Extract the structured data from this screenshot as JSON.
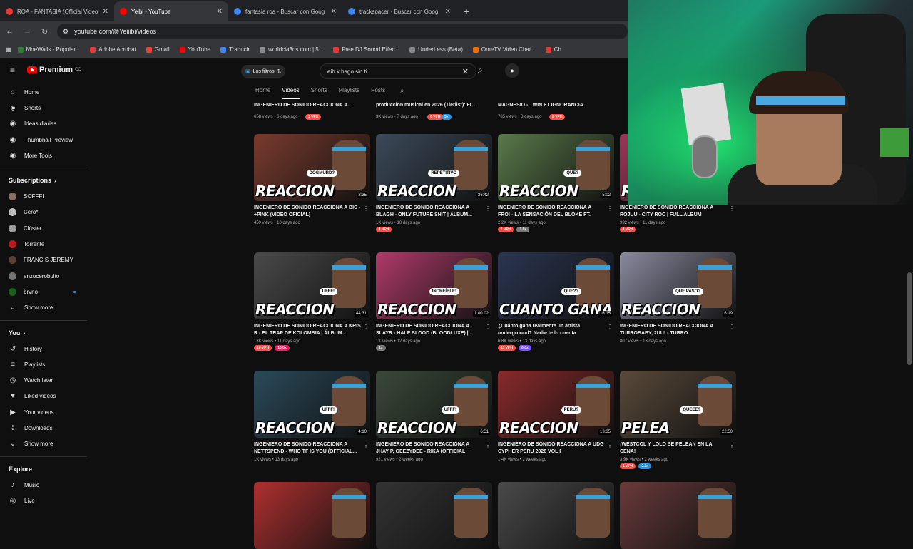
{
  "browser": {
    "tabs": [
      {
        "title": "ROA - FANTASÍA (Official Video",
        "color": "#e53935",
        "active": false
      },
      {
        "title": "Yeibi - YouTube",
        "color": "#ff0000",
        "active": true
      },
      {
        "title": "fantasía roa - Buscar con Goog",
        "color": "#4285f4",
        "active": false
      },
      {
        "title": "trackspacer - Buscar con Goog",
        "color": "#4285f4",
        "active": false
      }
    ],
    "new_tab": "+",
    "url": "youtube.com/@Yeiiibi/videos",
    "bookmarks": [
      {
        "label": "MoeWalls - Popular...",
        "color": "#2e7d32"
      },
      {
        "label": "Adobe Acrobat",
        "color": "#e53935"
      },
      {
        "label": "Gmail",
        "color": "#ea4335"
      },
      {
        "label": "YouTube",
        "color": "#ff0000"
      },
      {
        "label": "Traducir",
        "color": "#4285f4"
      },
      {
        "label": "worldcia3ds.com | 5...",
        "color": "#888888"
      },
      {
        "label": "Free DJ Sound Effec...",
        "color": "#e53935"
      },
      {
        "label": "UnderLess (Beta)",
        "color": "#888888"
      },
      {
        "label": "OmeTV Video Chat...",
        "color": "#ef6c00"
      },
      {
        "label": "Ch",
        "color": "#e53935"
      }
    ]
  },
  "yt": {
    "logo": "Premium",
    "logo_sup": "CO",
    "filters_label": "Los filtros",
    "search_value": "eib k hago sin ti",
    "sidebar": {
      "main": [
        {
          "label": "Home",
          "icon": "⌂"
        },
        {
          "label": "Shorts",
          "icon": "◈"
        },
        {
          "label": "Ideas diarias",
          "icon": "◉"
        },
        {
          "label": "Thumbnail Preview",
          "icon": "◉"
        },
        {
          "label": "More Tools",
          "icon": "◉"
        }
      ],
      "subs_title": "Subscriptions",
      "subs": [
        {
          "label": "SOFFFI",
          "color": "#8d6e63"
        },
        {
          "label": "Cero*",
          "color": "#bdbdbd"
        },
        {
          "label": "Clúster",
          "color": "#9e9e9e"
        },
        {
          "label": "Torrente",
          "color": "#b71c1c"
        },
        {
          "label": "FRANCIS JEREMY",
          "color": "#5d4037"
        },
        {
          "label": "enzocerobulto",
          "color": "#757575"
        },
        {
          "label": "brvno",
          "color": "#1b5e20"
        }
      ],
      "show_more": "Show more",
      "you_title": "You",
      "you": [
        {
          "label": "History",
          "icon": "↺"
        },
        {
          "label": "Playlists",
          "icon": "≡"
        },
        {
          "label": "Watch later",
          "icon": "◷"
        },
        {
          "label": "Liked videos",
          "icon": "♥"
        },
        {
          "label": "Your videos",
          "icon": "▶"
        },
        {
          "label": "Downloads",
          "icon": "⇣"
        }
      ],
      "show_more_2": "Show more",
      "explore_title": "Explore",
      "explore": [
        {
          "label": "Music",
          "icon": "♪"
        },
        {
          "label": "Live",
          "icon": "◎"
        }
      ]
    },
    "channel_tabs": [
      "Home",
      "Videos",
      "Shorts",
      "Playlists",
      "Posts"
    ],
    "top_row": [
      {
        "title": "INGENIERO DE SONIDO REACCIONA A...",
        "meta": "658 views • 6 days ago",
        "badge": "1 VPH"
      },
      {
        "title": "producción musical en 2026 (Tierlist): FL...",
        "meta": "3K views • 7 days ago",
        "badge": "6 VPH",
        "badge2": "3x"
      },
      {
        "title": "MAGNESIO - TWIN FT IGNORANCIA",
        "meta": "735 views • 8 days ago",
        "badge": "2 VPH"
      }
    ],
    "videos": [
      {
        "big": "REACCION",
        "bubble": "DOGMURD?",
        "dur": "3:35",
        "bg": "#7a3b2e",
        "title": "INGENIERO DE SONIDO REACCIONA A BIC - +PINK (VIDEO OFICIAL)",
        "meta": "459 views • 10 days ago",
        "badges": []
      },
      {
        "big": "REACCION",
        "bubble": "REPETITIVO",
        "dur": "36:42",
        "bg": "#3b4a5a",
        "title": "INGENIERO DE SONIDO REACCIONA A BLAGH - ONLY FUTURE SHIT | ÁLBUM...",
        "meta": "1K views • 10 days ago",
        "badges": [
          {
            "t": "1 VPH",
            "c": "#ff4e45"
          }
        ]
      },
      {
        "big": "REACCION",
        "bubble": "QUE?",
        "dur": "5:02",
        "bg": "#5a7a4a",
        "title": "INGENIERO DE SONIDO REACCIONA A FRO! - LA SENSACIÓN DEL BLOKE FT. PABLOXO",
        "meta": "2.2K views • 11 days ago",
        "badges": [
          {
            "t": "1 VPH",
            "c": "#ff4e45"
          },
          {
            "t": "1.8x",
            "c": "#777777"
          }
        ]
      },
      {
        "big": "REACCION",
        "bubble": "",
        "dur": "",
        "bg": "#a0365a",
        "title": "INGENIERO DE SONIDO REACCIONA A ROJUU - CITY ROC | FULL ALBUM",
        "meta": "932 views • 11 days ago",
        "badges": [
          {
            "t": "1 VPH",
            "c": "#ff4e45"
          }
        ]
      },
      {
        "big": "REACCION",
        "bubble": "UFFF!",
        "dur": "44:31",
        "bg": "#4a4a4a",
        "title": "INGENIERO DE SONIDO REACCIONA A KRIS R - EL TRAP DE KOLOMBIA | ÁLBUM...",
        "meta": "13K views • 11 days ago",
        "badges": [
          {
            "t": "18 VPH",
            "c": "#ff4e45"
          },
          {
            "t": "13.8x",
            "c": "#e91e63"
          }
        ]
      },
      {
        "big": "REACCION",
        "bubble": "INCREÍBLE!",
        "dur": "1:00:02",
        "bg": "#b03a6a",
        "title": "INGENIERO DE SONIDO REACCIONA A SLAYR - HALF BLOOD (BLOODLUXE) |...",
        "meta": "1K views • 12 days ago",
        "badges": [
          {
            "t": "1x",
            "c": "#777777"
          }
        ]
      },
      {
        "big": "CUANTO GANA",
        "bubble": "QUE??",
        "dur": "16:15",
        "bg": "#2a3550",
        "title": "¿Cuánto gana realmente un artista underground? Nadie te lo cuenta",
        "meta": "6.8K views • 13 days ago",
        "badges": [
          {
            "t": "11 VPH",
            "c": "#ff4e45"
          },
          {
            "t": "6.0x",
            "c": "#7c4dff"
          }
        ]
      },
      {
        "big": "REACCION",
        "bubble": "QUE PASO?",
        "dur": "6:19",
        "bg": "#8a8aa0",
        "title": "INGENIERO DE SONIDO REACCIONA A TURROBABY, 2UU! - TURRO",
        "meta": "807 views • 13 days ago",
        "badges": []
      },
      {
        "big": "REACCION",
        "bubble": "UFFF!",
        "dur": "4:10",
        "bg": "#2a4a5a",
        "title": "INGENIERO DE SONIDO REACCIONA A NETTSPEND - WHO TF IS YOU (OFFICIAL...",
        "meta": "1K views • 13 days ago",
        "badges": []
      },
      {
        "big": "REACCION",
        "bubble": "UFFF!",
        "dur": "6:51",
        "bg": "#3a4a3a",
        "title": "INGENIERO DE SONIDO REACCIONA A JHAY P, GEEZYDEE - RIKA (OFFICIAL VIDEO)",
        "meta": "921 views • 2 weeks ago",
        "badges": []
      },
      {
        "big": "REACCION",
        "bubble": "PERÚ?",
        "dur": "13:35",
        "bg": "#8a2a2a",
        "title": "INGENIERO DE SONIDO REACCIONA A UDG CYPHER PERU 2026 VOL I",
        "meta": "1.4K views • 2 weeks ago",
        "badges": []
      },
      {
        "big": "PELEA",
        "bubble": "QUEEE?",
        "dur": "22:50",
        "bg": "#5a4a3a",
        "title": "¡WESTCOL Y LOLO SE PELEAN EN LA CENA!",
        "meta": "3.9K views • 2 weeks ago",
        "badges": [
          {
            "t": "1 VPH",
            "c": "#ff4e45"
          },
          {
            "t": "2.1x",
            "c": "#2196f3"
          }
        ]
      },
      {
        "big": "",
        "bubble": "",
        "dur": "",
        "bg": "#b03030",
        "title": "",
        "meta": "",
        "badges": []
      },
      {
        "big": "",
        "bubble": "",
        "dur": "",
        "bg": "#333333",
        "title": "",
        "meta": "",
        "badges": []
      },
      {
        "big": "",
        "bubble": "",
        "dur": "",
        "bg": "#4a4a4a",
        "title": "",
        "meta": "",
        "badges": []
      },
      {
        "big": "",
        "bubble": "",
        "dur": "",
        "bg": "#6a3a3a",
        "title": "",
        "meta": "",
        "badges": []
      }
    ]
  }
}
